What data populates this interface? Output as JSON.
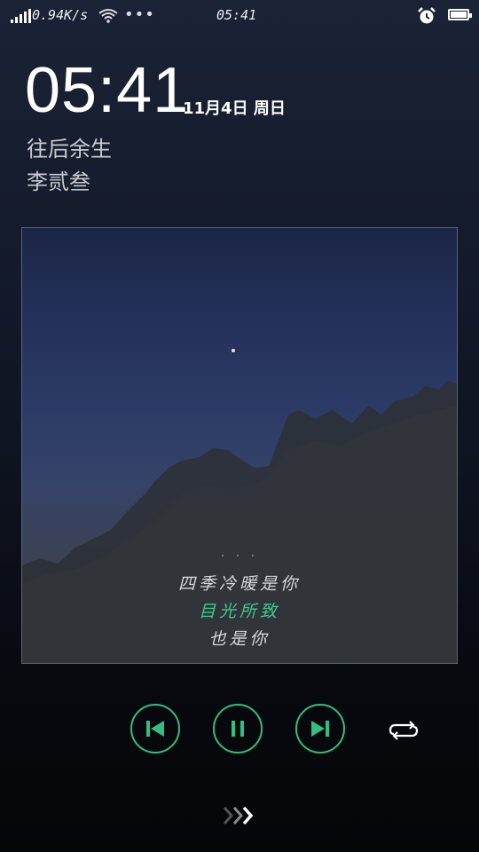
{
  "status_bar": {
    "speed": "0.94K/s",
    "time": "05:41",
    "more": "•••",
    "icons": [
      "signal-icon",
      "wifi-icon",
      "alarm-icon",
      "battery-icon"
    ]
  },
  "lockscreen": {
    "clock": "05:41",
    "date": "11月4日 周日"
  },
  "now_playing": {
    "title": "往后余生",
    "artist": "李贰叁",
    "lyrics": {
      "previous_partial": "· · ·",
      "line1": "四季冷暖是你",
      "current": "目光所致",
      "line3": "也是你"
    }
  },
  "controls": {
    "accent_color": "#2fbf80",
    "buttons": [
      "previous-button",
      "pause-button",
      "next-button",
      "repeat-button"
    ]
  },
  "unlock_hint": "❯❯❯"
}
